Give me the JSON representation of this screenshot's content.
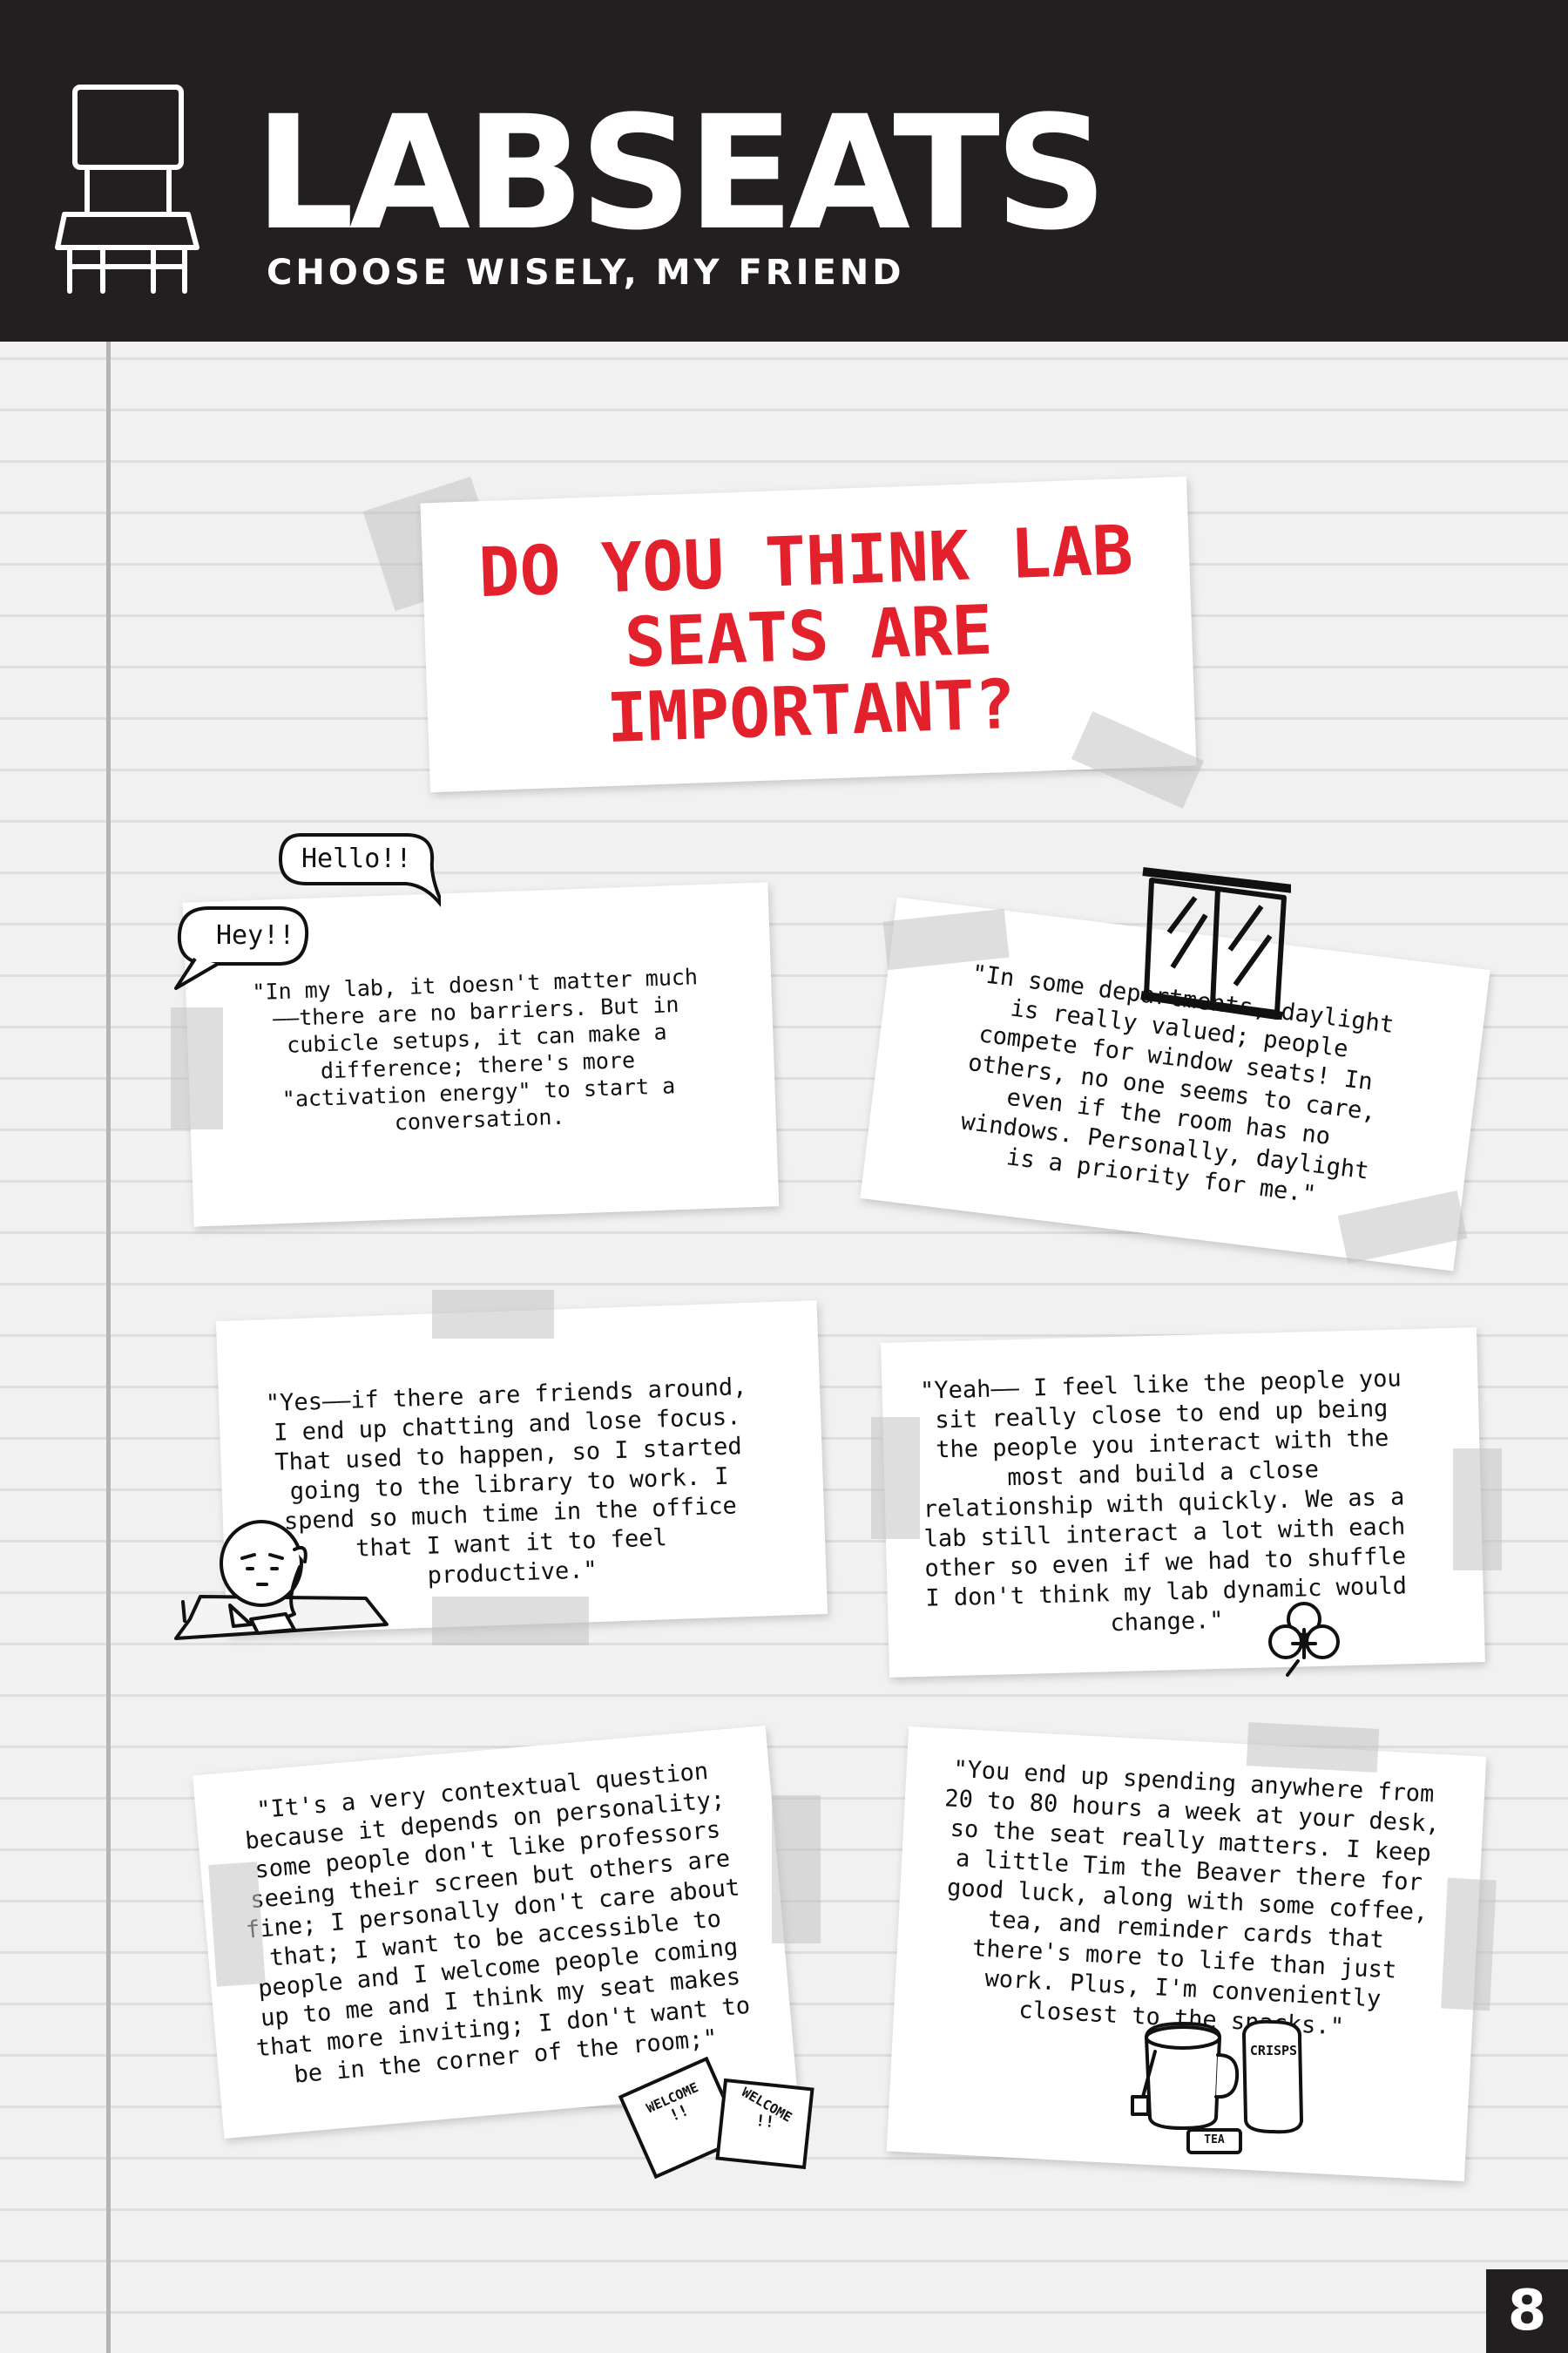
{
  "header": {
    "title": "LABSEATS",
    "subtitle": "CHOOSE WISELY, MY FRIEND"
  },
  "headline": "DO YOU THINK LAB SEATS ARE IMPORTANT?",
  "bubbles": {
    "hello": "Hello!!",
    "hey": "Hey!!"
  },
  "quotes": [
    "\"In my lab, it doesn't matter much——there are no barriers. But in cubicle setups, it can make a difference; there's more \"activation energy\" to start a conversation.",
    "\"In some departments, daylight is really valued; people compete for window seats! In others, no one seems to care, even if the room has no windows. Personally, daylight is a priority for me.\"",
    "\"Yes——if there are friends around, I end up chatting and lose focus. That used to happen, so I started going to the library to work. I spend so much time in the office that I want it to feel productive.\"",
    "\"Yeah—— I feel like the people you sit really close to end up being the people you interact with the most and build a close relationship with quickly. We as a lab still interact a lot with each other so even if we had to shuffle I don't think my lab dynamic would change.\"",
    "\"It's a very contextual question because it depends on personality; some people don't like professors seeing their screen but others are fine; I personally don't care about that; I want to be accessible to people and I welcome people coming up to me and I think my seat makes that more inviting; I don't want to be in the corner of the room;\"",
    "\"You end up spending anywhere from 20 to 80 hours a week at your desk, so the seat really matters. I keep a little Tim the Beaver there for good luck, along with some coffee, tea, and reminder cards that there's more to life than just work. Plus, I'm conveniently closest to the snacks.\""
  ],
  "doodle_labels": {
    "welcome": "WELCOME",
    "welcome_mark": "!!",
    "crisps": "CRISPS",
    "tea": "TEA"
  },
  "page_number": "8"
}
